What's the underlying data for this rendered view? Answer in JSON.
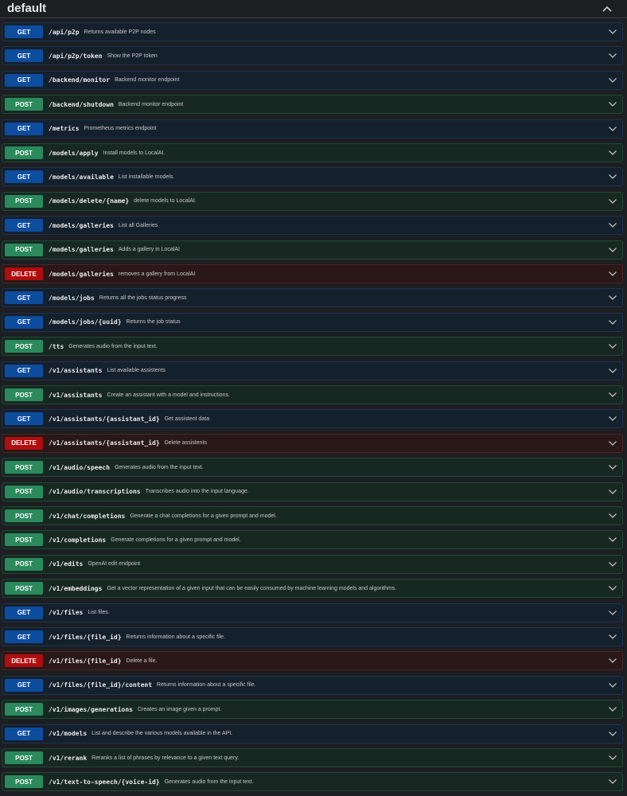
{
  "section": {
    "title": "default"
  },
  "colors": {
    "get": "#0d4d9e",
    "post": "#2a8a5c",
    "delete": "#b00d0d",
    "background": "#1c1e21"
  },
  "operations": [
    {
      "method": "GET",
      "path": "/api/p2p",
      "description": "Returns available P2P nodes"
    },
    {
      "method": "GET",
      "path": "/api/p2p/token",
      "description": "Show the P2P token"
    },
    {
      "method": "GET",
      "path": "/backend/monitor",
      "description": "Backend monitor endpoint"
    },
    {
      "method": "POST",
      "path": "/backend/shutdown",
      "description": "Backend monitor endpoint"
    },
    {
      "method": "GET",
      "path": "/metrics",
      "description": "Prometheus metrics endpoint"
    },
    {
      "method": "POST",
      "path": "/models/apply",
      "description": "Install models to LocalAI."
    },
    {
      "method": "GET",
      "path": "/models/available",
      "description": "List installable models."
    },
    {
      "method": "POST",
      "path": "/models/delete/{name}",
      "description": "delete models to LocalAI."
    },
    {
      "method": "GET",
      "path": "/models/galleries",
      "description": "List all Galleries"
    },
    {
      "method": "POST",
      "path": "/models/galleries",
      "description": "Adds a gallery in LocalAI"
    },
    {
      "method": "DELETE",
      "path": "/models/galleries",
      "description": "removes a gallery from LocalAI"
    },
    {
      "method": "GET",
      "path": "/models/jobs",
      "description": "Returns all the jobs status progress"
    },
    {
      "method": "GET",
      "path": "/models/jobs/{uuid}",
      "description": "Returns the job status"
    },
    {
      "method": "POST",
      "path": "/tts",
      "description": "Generates audio from the input text."
    },
    {
      "method": "GET",
      "path": "/v1/assistants",
      "description": "List available assistents"
    },
    {
      "method": "POST",
      "path": "/v1/assistants",
      "description": "Create an assistant with a model and instructions."
    },
    {
      "method": "GET",
      "path": "/v1/assistants/{assistant_id}",
      "description": "Get assistent data"
    },
    {
      "method": "DELETE",
      "path": "/v1/assistants/{assistant_id}",
      "description": "Delete assistents"
    },
    {
      "method": "POST",
      "path": "/v1/audio/speech",
      "description": "Generates audio from the input text."
    },
    {
      "method": "POST",
      "path": "/v1/audio/transcriptions",
      "description": "Transcribes audio into the input language."
    },
    {
      "method": "POST",
      "path": "/v1/chat/completions",
      "description": "Generate a chat completions for a given prompt and model."
    },
    {
      "method": "POST",
      "path": "/v1/completions",
      "description": "Generate completions for a given prompt and model."
    },
    {
      "method": "POST",
      "path": "/v1/edits",
      "description": "OpenAI edit endpoint"
    },
    {
      "method": "POST",
      "path": "/v1/embeddings",
      "description": "Get a vector representation of a given input that can be easily consumed by machine learning models and algorithms."
    },
    {
      "method": "GET",
      "path": "/v1/files",
      "description": "List files."
    },
    {
      "method": "GET",
      "path": "/v1/files/{file_id}",
      "description": "Returns information about a specific file."
    },
    {
      "method": "DELETE",
      "path": "/v1/files/{file_id}",
      "description": "Delete a file."
    },
    {
      "method": "GET",
      "path": "/v1/files/{file_id}/content",
      "description": "Returns information about a specific file."
    },
    {
      "method": "POST",
      "path": "/v1/images/generations",
      "description": "Creates an image given a prompt."
    },
    {
      "method": "GET",
      "path": "/v1/models",
      "description": "List and describe the various models available in the API."
    },
    {
      "method": "POST",
      "path": "/v1/rerank",
      "description": "Reranks a list of phrases by relevance to a given text query."
    },
    {
      "method": "POST",
      "path": "/v1/text-to-speech/{voice-id}",
      "description": "Generates audio from the input text."
    }
  ]
}
